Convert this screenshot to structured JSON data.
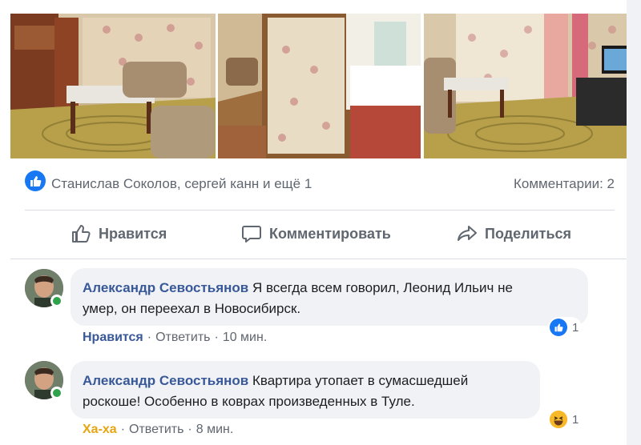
{
  "post": {
    "photos": [
      {
        "icon": "living-room-photo"
      },
      {
        "icon": "bedroom-doorway-photo"
      },
      {
        "icon": "living-room-tv-photo"
      }
    ],
    "summary": {
      "names": "Станислав Соколов, сергей канн и ещё 1",
      "comments_count": "Комментарии: 2"
    },
    "actions": {
      "like": "Нравится",
      "comment": "Комментировать",
      "share": "Поделиться"
    }
  },
  "comments": [
    {
      "author": "Александр Севостьянов",
      "text_line1": "Я всегда всем говорил, Леонид Ильич не",
      "text_line2": "умер, он переехал в Новосибирск.",
      "reaction_label": "Нравится",
      "reply_label": "Ответить",
      "time": "10 мин.",
      "reaction_icon": "like-icon",
      "reaction_count": "1"
    },
    {
      "author": "Александр Севостьянов",
      "text_line1": "Квартира утопает в сумасшедшей",
      "text_line2": "роскоше! Особенно в коврах произведенных в Туле.",
      "reaction_label": "Ха-ха",
      "reply_label": "Ответить",
      "time": "8 мин.",
      "reaction_icon": "haha-icon",
      "reaction_count": "1"
    }
  ],
  "colors": {
    "link_blue": "#385898",
    "like_blue": "#1877f2",
    "haha_yellow": "#e7a512",
    "online_green": "#31a24c",
    "secondary_text": "#606770"
  }
}
